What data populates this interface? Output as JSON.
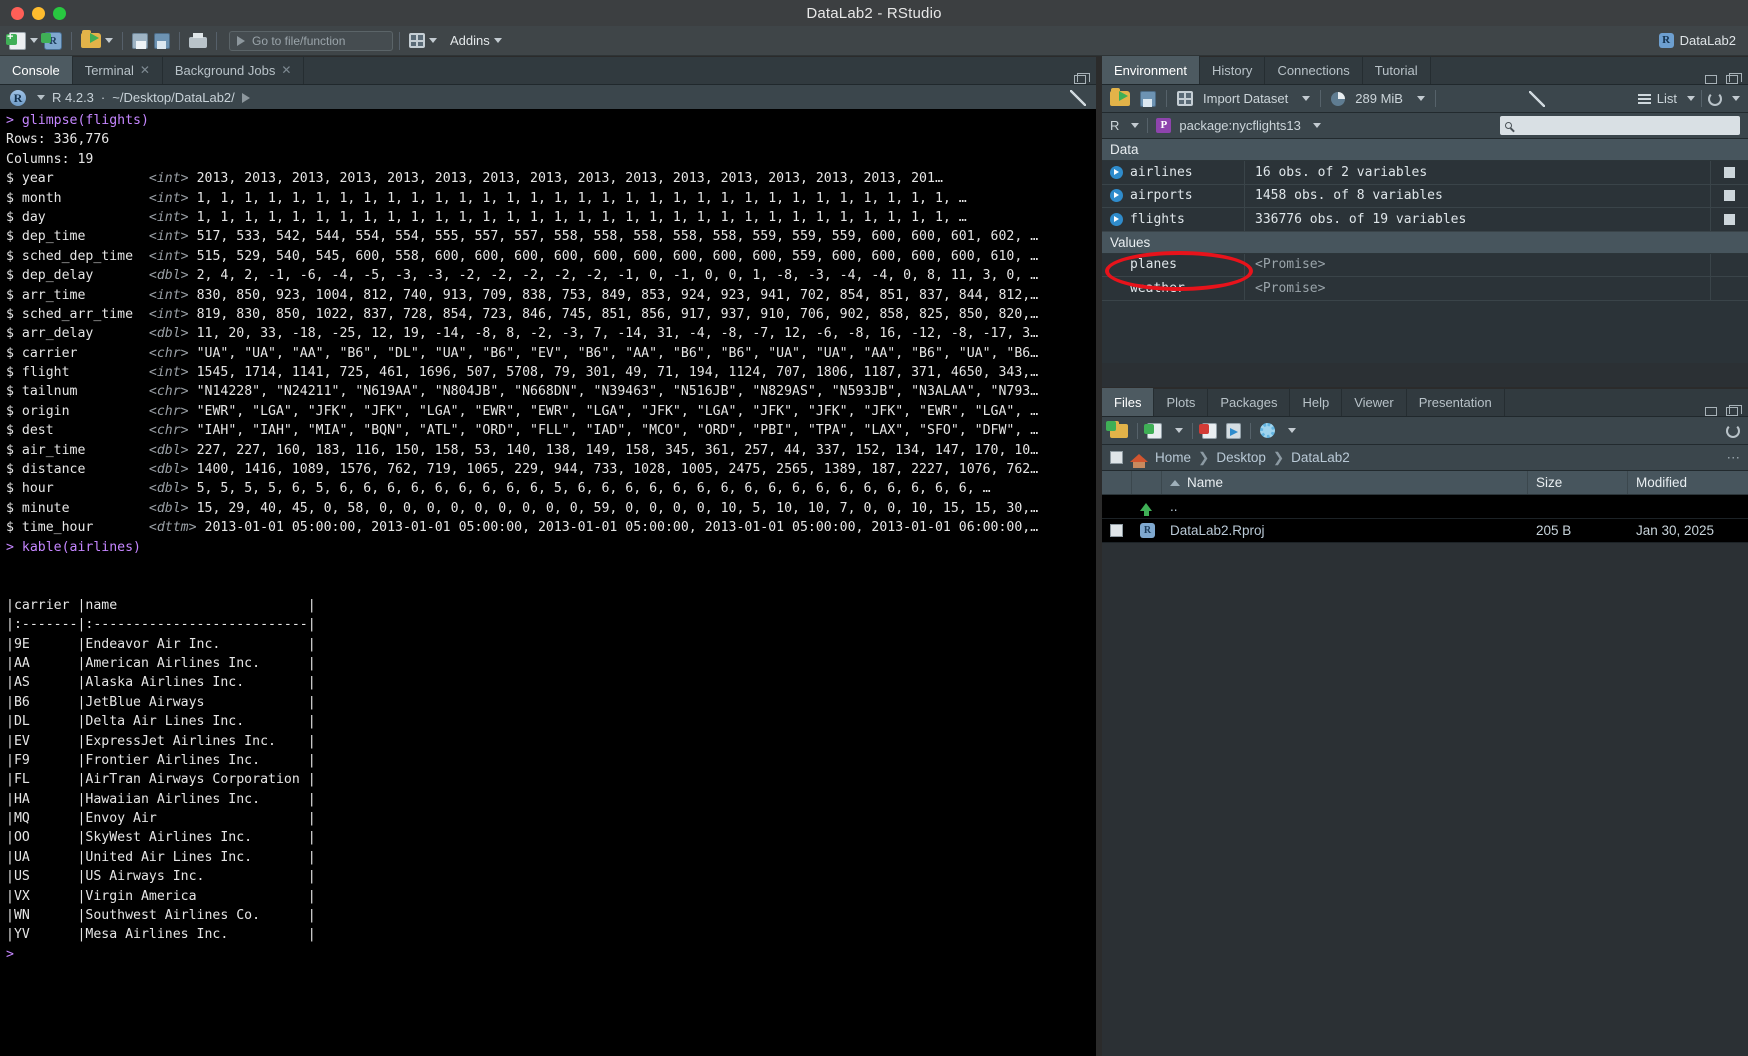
{
  "window": {
    "title": "DataLab2 - RStudio"
  },
  "toolbar": {
    "goto_placeholder": "Go to file/function",
    "addins_label": "Addins",
    "project_label": "DataLab2",
    "icons": {
      "new_file": "new-file-icon",
      "new_project": "new-project-icon",
      "open_file": "open-file-icon",
      "save": "save-icon",
      "save_all": "save-all-icon",
      "print": "print-icon",
      "workspace_panes": "workspace-panes-icon"
    }
  },
  "console": {
    "tabs": [
      {
        "label": "Console",
        "active": true,
        "closable": false
      },
      {
        "label": "Terminal",
        "active": false,
        "closable": true
      },
      {
        "label": "Background Jobs",
        "active": false,
        "closable": true
      }
    ],
    "r_version": "R 4.2.3",
    "separator": "·",
    "working_dir": "~/Desktop/DataLab2/",
    "lines": [
      {
        "type": "cmd",
        "text": "> glimpse(flights)"
      },
      {
        "type": "out",
        "text": "Rows: 336,776"
      },
      {
        "type": "out",
        "text": "Columns: 19"
      },
      {
        "name": "$ year",
        "dtype": "<int>",
        "values": "2013, 2013, 2013, 2013, 2013, 2013, 2013, 2013, 2013, 2013, 2013, 2013, 2013, 2013, 2013, 201…"
      },
      {
        "name": "$ month",
        "dtype": "<int>",
        "values": "1, 1, 1, 1, 1, 1, 1, 1, 1, 1, 1, 1, 1, 1, 1, 1, 1, 1, 1, 1, 1, 1, 1, 1, 1, 1, 1, 1, 1, 1, 1, 1, …"
      },
      {
        "name": "$ day",
        "dtype": "<int>",
        "values": "1, 1, 1, 1, 1, 1, 1, 1, 1, 1, 1, 1, 1, 1, 1, 1, 1, 1, 1, 1, 1, 1, 1, 1, 1, 1, 1, 1, 1, 1, 1, 1, …"
      },
      {
        "name": "$ dep_time",
        "dtype": "<int>",
        "values": "517, 533, 542, 544, 554, 554, 555, 557, 557, 558, 558, 558, 558, 558, 559, 559, 559, 600, 600, 601, 602, …"
      },
      {
        "name": "$ sched_dep_time",
        "dtype": "<int>",
        "values": "515, 529, 540, 545, 600, 558, 600, 600, 600, 600, 600, 600, 600, 600, 600, 559, 600, 600, 600, 600, 610, …"
      },
      {
        "name": "$ dep_delay",
        "dtype": "<dbl>",
        "values": "2, 4, 2, -1, -6, -4, -5, -3, -3, -2, -2, -2, -2, -2, -1, 0, -1, 0, 0, 1, -8, -3, -4, -4, 0, 8, 11, 3, 0, …"
      },
      {
        "name": "$ arr_time",
        "dtype": "<int>",
        "values": "830, 850, 923, 1004, 812, 740, 913, 709, 838, 753, 849, 853, 924, 923, 941, 702, 854, 851, 837, 844, 812,…"
      },
      {
        "name": "$ sched_arr_time",
        "dtype": "<int>",
        "values": "819, 830, 850, 1022, 837, 728, 854, 723, 846, 745, 851, 856, 917, 937, 910, 706, 902, 858, 825, 850, 820,…"
      },
      {
        "name": "$ arr_delay",
        "dtype": "<dbl>",
        "values": "11, 20, 33, -18, -25, 12, 19, -14, -8, 8, -2, -3, 7, -14, 31, -4, -8, -7, 12, -6, -8, 16, -12, -8, -17, 3…"
      },
      {
        "name": "$ carrier",
        "dtype": "<chr>",
        "values": "\"UA\", \"UA\", \"AA\", \"B6\", \"DL\", \"UA\", \"B6\", \"EV\", \"B6\", \"AA\", \"B6\", \"B6\", \"UA\", \"UA\", \"AA\", \"B6\", \"UA\", \"B6…"
      },
      {
        "name": "$ flight",
        "dtype": "<int>",
        "values": "1545, 1714, 1141, 725, 461, 1696, 507, 5708, 79, 301, 49, 71, 194, 1124, 707, 1806, 1187, 371, 4650, 343,…"
      },
      {
        "name": "$ tailnum",
        "dtype": "<chr>",
        "values": "\"N14228\", \"N24211\", \"N619AA\", \"N804JB\", \"N668DN\", \"N39463\", \"N516JB\", \"N829AS\", \"N593JB\", \"N3ALAA\", \"N793…"
      },
      {
        "name": "$ origin",
        "dtype": "<chr>",
        "values": "\"EWR\", \"LGA\", \"JFK\", \"JFK\", \"LGA\", \"EWR\", \"EWR\", \"LGA\", \"JFK\", \"LGA\", \"JFK\", \"JFK\", \"JFK\", \"EWR\", \"LGA\", …"
      },
      {
        "name": "$ dest",
        "dtype": "<chr>",
        "values": "\"IAH\", \"IAH\", \"MIA\", \"BQN\", \"ATL\", \"ORD\", \"FLL\", \"IAD\", \"MCO\", \"ORD\", \"PBI\", \"TPA\", \"LAX\", \"SFO\", \"DFW\", …"
      },
      {
        "name": "$ air_time",
        "dtype": "<dbl>",
        "values": "227, 227, 160, 183, 116, 150, 158, 53, 140, 138, 149, 158, 345, 361, 257, 44, 337, 152, 134, 147, 170, 10…"
      },
      {
        "name": "$ distance",
        "dtype": "<dbl>",
        "values": "1400, 1416, 1089, 1576, 762, 719, 1065, 229, 944, 733, 1028, 1005, 2475, 2565, 1389, 187, 2227, 1076, 762…"
      },
      {
        "name": "$ hour",
        "dtype": "<dbl>",
        "values": "5, 5, 5, 5, 6, 5, 6, 6, 6, 6, 6, 6, 6, 6, 6, 5, 6, 6, 6, 6, 6, 6, 6, 6, 6, 6, 6, 6, 6, 6, 6, 6, 6, …"
      },
      {
        "name": "$ minute",
        "dtype": "<dbl>",
        "values": "15, 29, 40, 45, 0, 58, 0, 0, 0, 0, 0, 0, 0, 0, 0, 59, 0, 0, 0, 0, 10, 5, 10, 10, 7, 0, 0, 10, 15, 15, 30,…"
      },
      {
        "name": "$ time_hour",
        "dtype": "<dttm>",
        "values": "2013-01-01 05:00:00, 2013-01-01 05:00:00, 2013-01-01 05:00:00, 2013-01-01 05:00:00, 2013-01-01 06:00:00,…"
      },
      {
        "type": "cmd",
        "text": "> kable(airlines)"
      },
      {
        "type": "blank",
        "text": ""
      },
      {
        "type": "blank",
        "text": ""
      },
      {
        "type": "out",
        "text": "|carrier |name                        |"
      },
      {
        "type": "out",
        "text": "|:-------|:---------------------------|"
      },
      {
        "type": "out",
        "text": "|9E      |Endeavor Air Inc.           |"
      },
      {
        "type": "out",
        "text": "|AA      |American Airlines Inc.      |"
      },
      {
        "type": "out",
        "text": "|AS      |Alaska Airlines Inc.        |"
      },
      {
        "type": "out",
        "text": "|B6      |JetBlue Airways             |"
      },
      {
        "type": "out",
        "text": "|DL      |Delta Air Lines Inc.        |"
      },
      {
        "type": "out",
        "text": "|EV      |ExpressJet Airlines Inc.    |"
      },
      {
        "type": "out",
        "text": "|F9      |Frontier Airlines Inc.      |"
      },
      {
        "type": "out",
        "text": "|FL      |AirTran Airways Corporation |"
      },
      {
        "type": "out",
        "text": "|HA      |Hawaiian Airlines Inc.      |"
      },
      {
        "type": "out",
        "text": "|MQ      |Envoy Air                   |"
      },
      {
        "type": "out",
        "text": "|OO      |SkyWest Airlines Inc.       |"
      },
      {
        "type": "out",
        "text": "|UA      |United Air Lines Inc.       |"
      },
      {
        "type": "out",
        "text": "|US      |US Airways Inc.             |"
      },
      {
        "type": "out",
        "text": "|VX      |Virgin America              |"
      },
      {
        "type": "out",
        "text": "|WN      |Southwest Airlines Co.      |"
      },
      {
        "type": "out",
        "text": "|YV      |Mesa Airlines Inc.          |"
      },
      {
        "type": "cmd",
        "text": "> "
      }
    ]
  },
  "environment": {
    "tabs": [
      {
        "label": "Environment",
        "active": true
      },
      {
        "label": "History",
        "active": false
      },
      {
        "label": "Connections",
        "active": false
      },
      {
        "label": "Tutorial",
        "active": false
      }
    ],
    "toolbar": {
      "import_dataset": "Import Dataset",
      "memory": "289 MiB",
      "view_mode": "List"
    },
    "scope": "R",
    "package_filter": "package:nycflights13",
    "search_placeholder": "",
    "sections": [
      {
        "title": "Data",
        "rows": [
          {
            "name": "airlines",
            "value": "16 obs. of 2 variables",
            "has_expand": true,
            "has_grid": true
          },
          {
            "name": "airports",
            "value": "1458 obs. of 8 variables",
            "has_expand": true,
            "has_grid": true
          },
          {
            "name": "flights",
            "value": "336776 obs. of 19 variables",
            "has_expand": true,
            "has_grid": true,
            "annotated": true
          }
        ]
      },
      {
        "title": "Values",
        "rows": [
          {
            "name": "planes",
            "value": "<Promise>",
            "has_expand": false,
            "has_grid": false
          },
          {
            "name": "weather",
            "value": "<Promise>",
            "has_expand": false,
            "has_grid": false
          }
        ]
      }
    ]
  },
  "files": {
    "tabs": [
      {
        "label": "Files",
        "active": true
      },
      {
        "label": "Plots",
        "active": false
      },
      {
        "label": "Packages",
        "active": false
      },
      {
        "label": "Help",
        "active": false
      },
      {
        "label": "Viewer",
        "active": false
      },
      {
        "label": "Presentation",
        "active": false
      }
    ],
    "breadcrumb": [
      "Home",
      "Desktop",
      "DataLab2"
    ],
    "columns": {
      "name": "Name",
      "size": "Size",
      "modified": "Modified"
    },
    "rows": [
      {
        "name": "..",
        "size": "",
        "modified": "",
        "kind": "parent"
      },
      {
        "name": "DataLab2.Rproj",
        "size": "205 B",
        "modified": "Jan 30, 2025",
        "kind": "rproj"
      }
    ]
  }
}
